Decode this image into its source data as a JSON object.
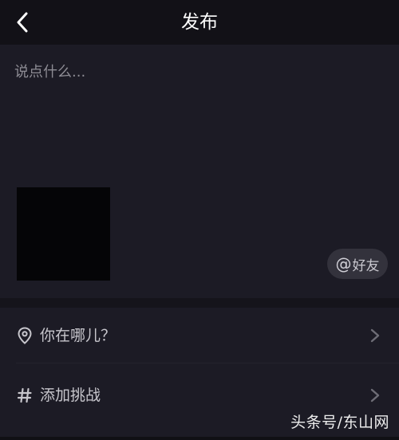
{
  "header": {
    "title": "发布",
    "back_icon": "chevron-left-icon"
  },
  "compose": {
    "caption_placeholder": "说点什么...",
    "mention": {
      "symbol": "@",
      "label": "好友"
    }
  },
  "options": [
    {
      "icon": "location-pin-icon",
      "label": "你在哪儿？"
    },
    {
      "icon": "hashtag-icon",
      "label": "添加挑战"
    }
  ],
  "watermark": "头条号/东山网",
  "colors": {
    "background": "#1c1b25",
    "header": "#121117",
    "text_primary": "#ffffff",
    "text_secondary": "#c7c6cc",
    "placeholder": "#8d8c94",
    "chip": "#33323c"
  }
}
